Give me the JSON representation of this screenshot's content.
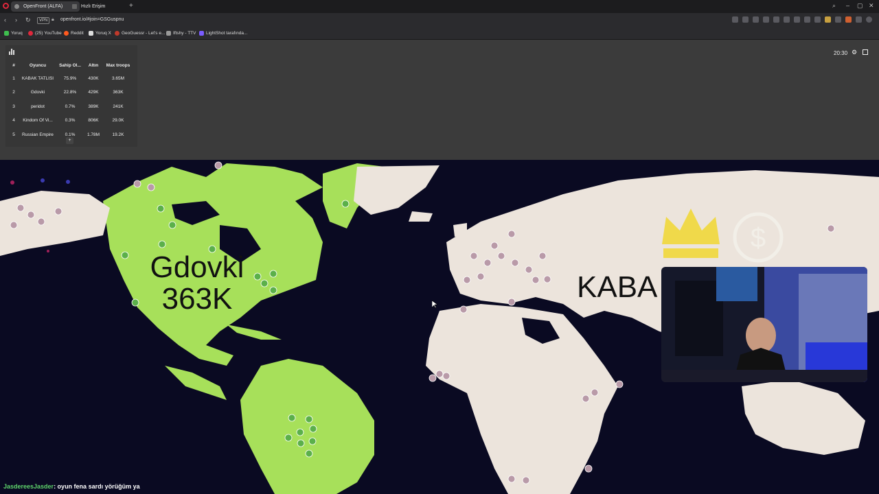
{
  "browser": {
    "tabs": [
      {
        "label": "OpenFront (ALFA)",
        "active": true
      },
      {
        "label": "Hızlı Erişim",
        "active": false
      }
    ],
    "url": "openfront.io/#join=GSGuspnu",
    "vpn_label": "VPN",
    "bookmarks": [
      {
        "label": "Yoruq",
        "color": "#3fbf4f"
      },
      {
        "label": "(25) YouTube",
        "color": "#e0283c"
      },
      {
        "label": "Reddit",
        "color": "#ff5a1f"
      },
      {
        "label": "Yoruq X",
        "color": "#dddddd"
      },
      {
        "label": "GeoGuessr - Let's e...",
        "color": "#c0392b"
      },
      {
        "label": "Iftshy - TTV",
        "color": "#999999"
      },
      {
        "label": "LightShot tarafında...",
        "color": "#7a5cff"
      }
    ]
  },
  "leaderboard": {
    "columns": [
      "#",
      "Oyuncu",
      "Sahip Ol...",
      "Altın",
      "Max troops"
    ],
    "rows": [
      {
        "rank": "1",
        "player": "KABAK TATLISI",
        "owned": "75.9%",
        "gold": "430K",
        "troops": "3.65M"
      },
      {
        "rank": "2",
        "player": "Gdovki",
        "owned": "22.8%",
        "gold": "429K",
        "troops": "363K"
      },
      {
        "rank": "3",
        "player": "peridot",
        "owned": "0.7%",
        "gold": "389K",
        "troops": "241K"
      },
      {
        "rank": "4",
        "player": "Kindom Of Vi...",
        "owned": "0.3%",
        "gold": "806K",
        "troops": "29.0K"
      },
      {
        "rank": "5",
        "player": "Russian Empire",
        "owned": "0.1%",
        "gold": "1.78M",
        "troops": "19.2K"
      }
    ],
    "expand_label": "+"
  },
  "hud": {
    "timer": "20:30"
  },
  "map": {
    "player_label_1_name": "Gdovki",
    "player_label_1_troops": "363K",
    "player_label_2_name": "KABA",
    "colors": {
      "ocean": "#0a0a22",
      "gdovki": "#a7e05a",
      "kabak": "#ece4dc",
      "structure": "#b99aa8"
    }
  },
  "chat": {
    "sender": "JasdereesJasder",
    "message": ": oyun fena sardı yörüğüm ya"
  }
}
